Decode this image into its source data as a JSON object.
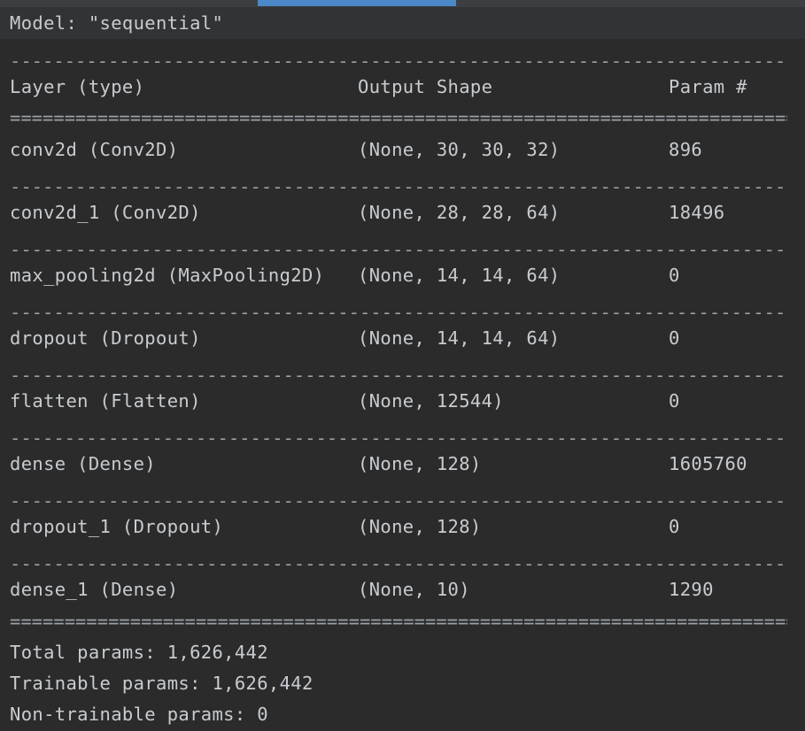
{
  "model_line": "Model: \"sequential\"",
  "rule_dash": "--------------------------------------------------------------------------------------------------------------------------",
  "rule_equal": "==========================================================================================================================",
  "header": {
    "layer": "Layer (type)",
    "shape": "Output Shape",
    "param": "Param #"
  },
  "rows": [
    {
      "layer": "conv2d (Conv2D)",
      "shape": "(None, 30, 30, 32)",
      "param": "896"
    },
    {
      "layer": "conv2d_1 (Conv2D)",
      "shape": "(None, 28, 28, 64)",
      "param": "18496"
    },
    {
      "layer": "max_pooling2d (MaxPooling2D)",
      "shape": "(None, 14, 14, 64)",
      "param": "0"
    },
    {
      "layer": "dropout (Dropout)",
      "shape": "(None, 14, 14, 64)",
      "param": "0"
    },
    {
      "layer": "flatten (Flatten)",
      "shape": "(None, 12544)",
      "param": "0"
    },
    {
      "layer": "dense (Dense)",
      "shape": "(None, 128)",
      "param": "1605760"
    },
    {
      "layer": "dropout_1 (Dropout)",
      "shape": "(None, 128)",
      "param": "0"
    },
    {
      "layer": "dense_1 (Dense)",
      "shape": "(None, 10)",
      "param": "1290"
    }
  ],
  "totals": {
    "total": "Total params: 1,626,442",
    "trainable": "Trainable params: 1,626,442",
    "non_trainable": "Non-trainable params: 0"
  }
}
